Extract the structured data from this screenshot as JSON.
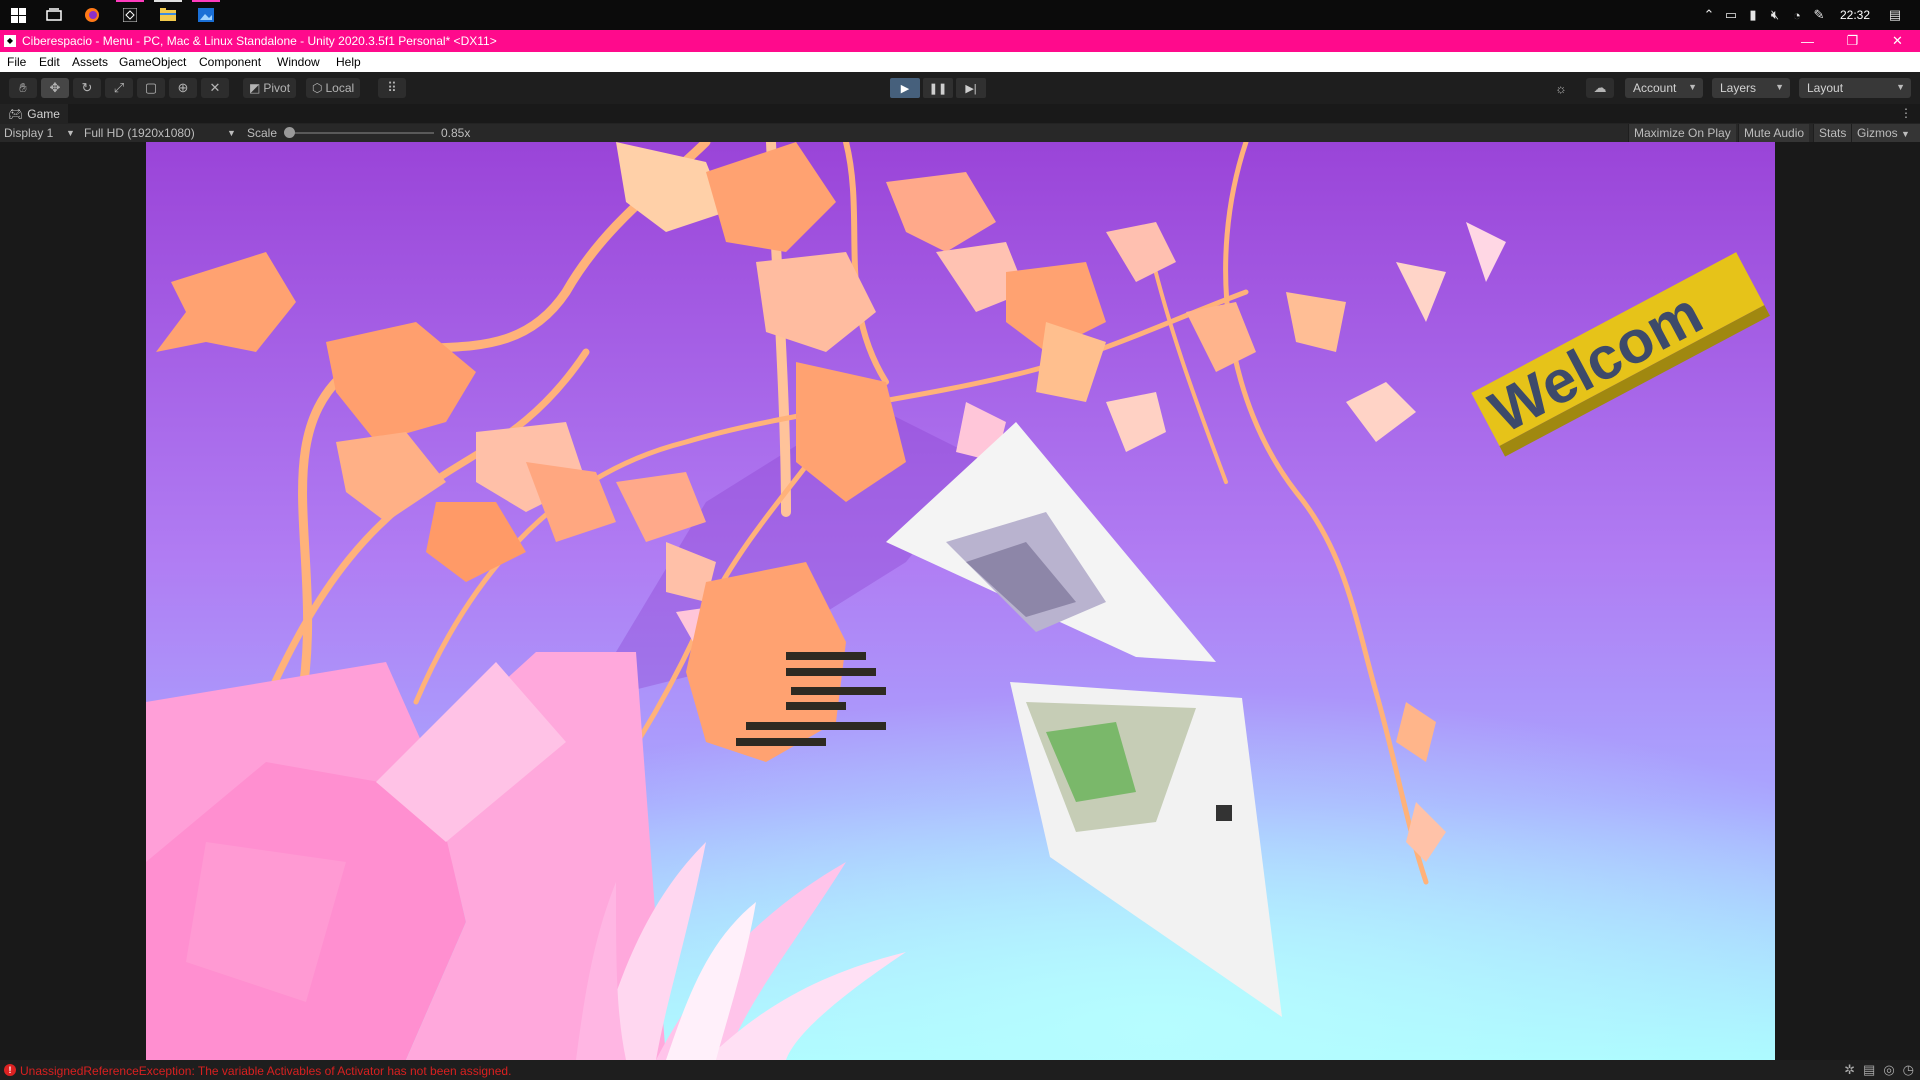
{
  "taskbar": {
    "tray_icons": [
      "chevron-up-icon",
      "meet-now-icon",
      "battery-icon",
      "volume-muted-icon",
      "wifi-icon",
      "pen-icon"
    ],
    "clock": "22:32"
  },
  "window": {
    "title": "Ciberespacio - Menu - PC, Mac & Linux Standalone - Unity 2020.3.5f1 Personal* <DX11>",
    "accent": "#ff0a8c"
  },
  "menu": [
    "File",
    "Edit",
    "Assets",
    "GameObject",
    "Component",
    "Window",
    "Help"
  ],
  "toolbar": {
    "pivot_label": "Pivot",
    "local_label": "Local",
    "account_label": "Account",
    "layers_label": "Layers",
    "layout_label": "Layout"
  },
  "game_tab": {
    "label": "Game"
  },
  "game_bar": {
    "display": "Display 1",
    "resolution": "Full HD (1920x1080)",
    "scale_label": "Scale",
    "scale_value": "0.85x",
    "maximize_on_play": "Maximize On Play",
    "mute_audio": "Mute Audio",
    "stats": "Stats",
    "gizmos": "Gizmos"
  },
  "scene": {
    "welcome_text": "Welcom",
    "sky_top": "#a24cde",
    "sky_mid": "#b27cf2",
    "sky_bottom": "#aaf8ff",
    "leaf_color": "#ffa271",
    "crystal_color": "#ff9fd8"
  },
  "status": {
    "error": "UnassignedReferenceException: The variable Activables of Activator has not been assigned."
  }
}
